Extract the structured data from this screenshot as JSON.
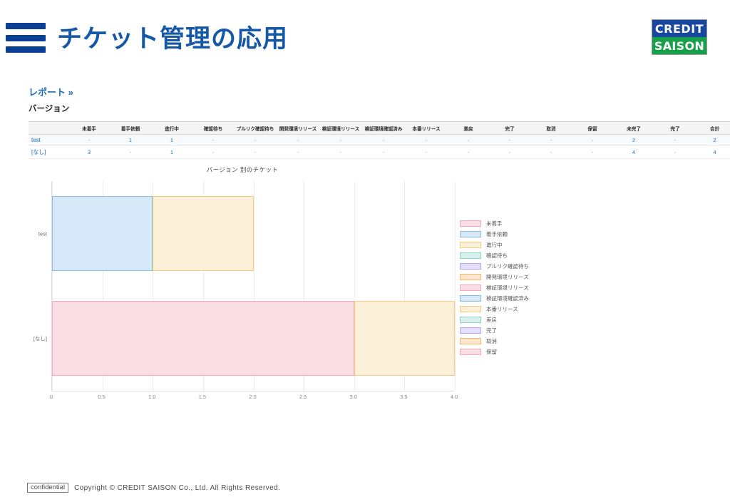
{
  "header": {
    "title": "チケット管理の応用",
    "menu_icon": "hamburger-icon",
    "logo": {
      "top_text": "CREDIT",
      "bottom_text": "SAISON",
      "top_color": "#17479e",
      "bottom_color": "#17a04a"
    }
  },
  "breadcrumb": {
    "report_link": "レポート »",
    "section_label": "バージョン"
  },
  "table": {
    "columns": [
      "",
      "未着手",
      "着手依頼",
      "進行中",
      "確認待ち",
      "プルリク確認待ち",
      "開発環境リリース",
      "検証環境リリース",
      "検証環境確認済み",
      "本番リリース",
      "差戻",
      "完了",
      "取消",
      "保留",
      "未完了",
      "完了",
      "合計"
    ],
    "rows": [
      {
        "name": "test",
        "cells": [
          "-",
          "1",
          "1",
          "-",
          "-",
          "-",
          "-",
          "-",
          "-",
          "-",
          "-",
          "-",
          "-",
          "2",
          "-",
          "2"
        ]
      },
      {
        "name": "[なし]",
        "cells": [
          "3",
          "-",
          "1",
          "-",
          "-",
          "-",
          "-",
          "-",
          "-",
          "-",
          "-",
          "-",
          "-",
          "4",
          "-",
          "4"
        ]
      }
    ]
  },
  "chart_data": {
    "type": "bar",
    "orientation": "horizontal",
    "stacked": true,
    "title": "バージョン 別のチケット",
    "xlabel": "",
    "ylabel": "",
    "categories": [
      "test",
      "[なし]"
    ],
    "xlim": [
      0,
      4
    ],
    "xticks": [
      "0",
      "0.5",
      "1.0",
      "1.5",
      "2.0",
      "2.5",
      "3.0",
      "3.5",
      "4.0"
    ],
    "grid": true,
    "legend_position": "right",
    "series": [
      {
        "name": "未着手",
        "values": [
          0,
          3
        ],
        "fill": "#fbdde4",
        "stroke": "#f5a8bc"
      },
      {
        "name": "着手依頼",
        "values": [
          1,
          0
        ],
        "fill": "#d7e9f8",
        "stroke": "#87bfe5"
      },
      {
        "name": "進行中",
        "values": [
          1,
          1
        ],
        "fill": "#fdf0d9",
        "stroke": "#f6cc81"
      },
      {
        "name": "確認待ち",
        "values": [
          0,
          0
        ],
        "fill": "#d9f0ec",
        "stroke": "#8fd4c8"
      },
      {
        "name": "プルリク確認待ち",
        "values": [
          0,
          0
        ],
        "fill": "#e5deff",
        "stroke": "#b3a6f2"
      },
      {
        "name": "開発環境リリース",
        "values": [
          0,
          0
        ],
        "fill": "#fde6cd",
        "stroke": "#f7b96a"
      },
      {
        "name": "検証環境リリース",
        "values": [
          0,
          0
        ],
        "fill": "#fbdde4",
        "stroke": "#f5a8bc"
      },
      {
        "name": "検証環境確認済み",
        "values": [
          0,
          0
        ],
        "fill": "#d7e9f8",
        "stroke": "#87bfe5"
      },
      {
        "name": "本番リリース",
        "values": [
          0,
          0
        ],
        "fill": "#fdf0d9",
        "stroke": "#f6cc81"
      },
      {
        "name": "差戻",
        "values": [
          0,
          0
        ],
        "fill": "#d9f0ec",
        "stroke": "#8fd4c8"
      },
      {
        "name": "完了",
        "values": [
          0,
          0
        ],
        "fill": "#e5deff",
        "stroke": "#b3a6f2"
      },
      {
        "name": "取消",
        "values": [
          0,
          0
        ],
        "fill": "#fde6cd",
        "stroke": "#f7b96a"
      },
      {
        "name": "保留",
        "values": [
          0,
          0
        ],
        "fill": "#fbdde4",
        "stroke": "#f5a8bc"
      }
    ]
  },
  "footer": {
    "confidential": "confidential",
    "copyright": "Copyright © CREDIT SAISON Co., Ltd. All Rights Reserved."
  }
}
